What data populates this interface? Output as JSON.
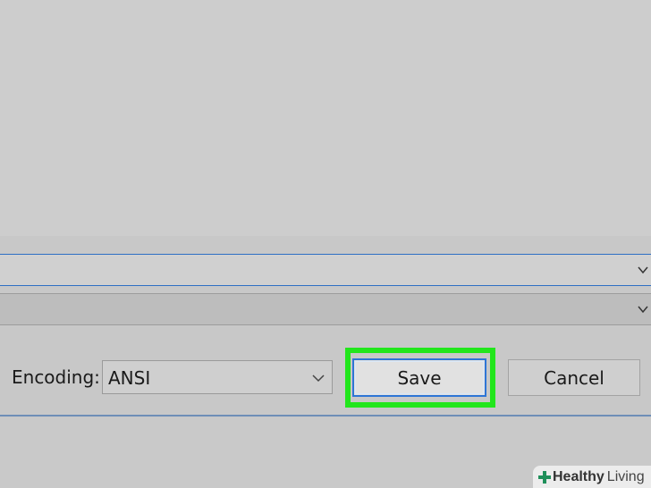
{
  "dialog": {
    "encoding": {
      "label": "Encoding:",
      "value": "ANSI"
    },
    "buttons": {
      "save_label": "Save",
      "cancel_label": "Cancel"
    },
    "highlight_color": "#22e61c",
    "accent_color": "#2d75d6"
  },
  "watermark": {
    "brand_bold": "Healthy",
    "brand_light": "Living"
  }
}
